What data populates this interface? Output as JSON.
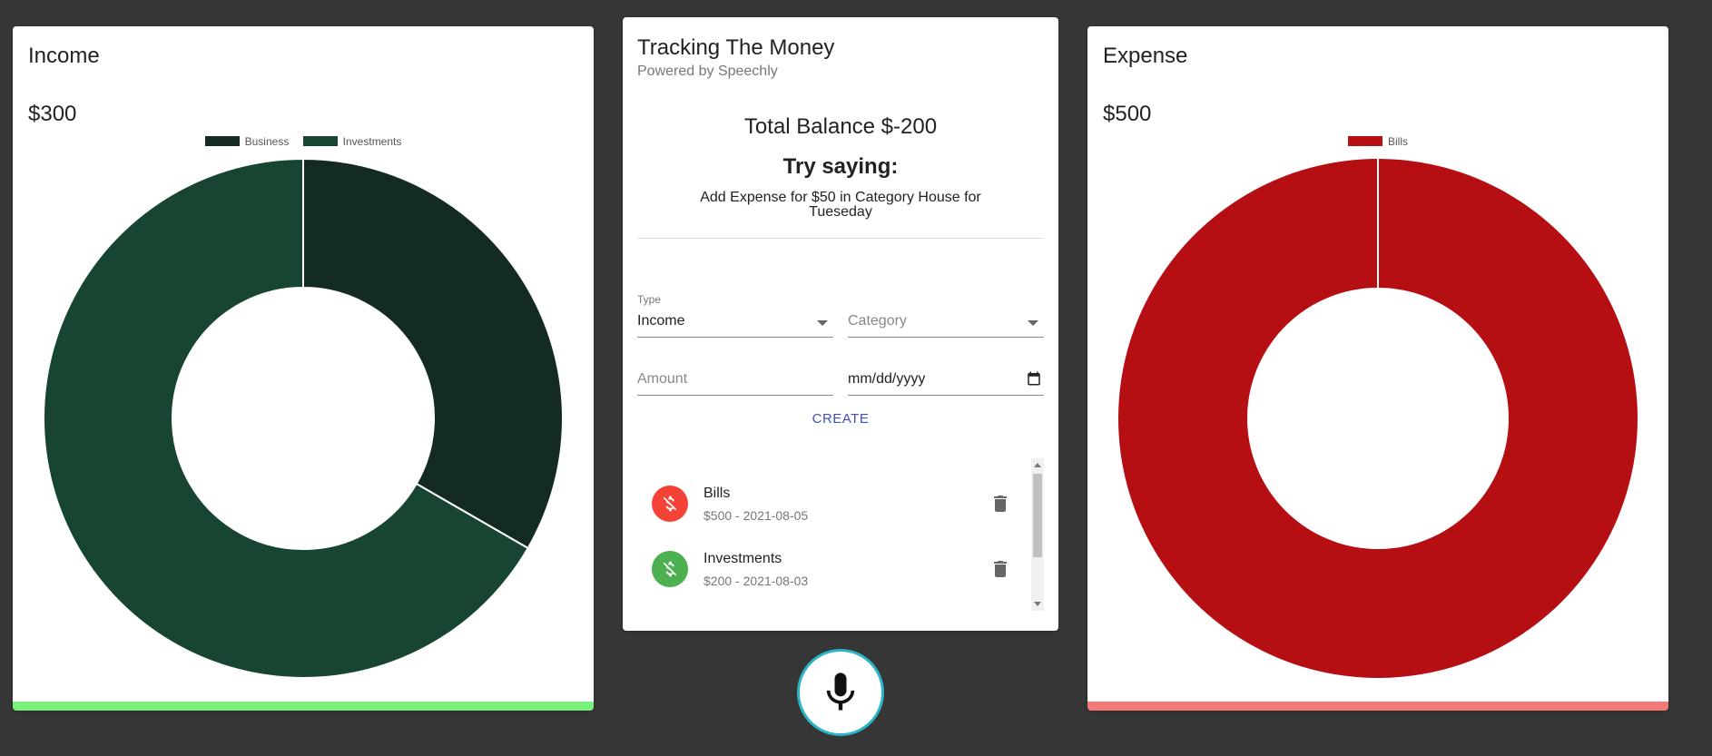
{
  "income": {
    "title": "Income",
    "amount": "$300",
    "legend": [
      {
        "label": "Business",
        "color": "#142b21"
      },
      {
        "label": "Investments",
        "color": "#174532"
      }
    ]
  },
  "expense": {
    "title": "Expense",
    "amount": "$500",
    "legend": [
      {
        "label": "Bills",
        "color": "#b50e13"
      }
    ]
  },
  "main": {
    "title": "Tracking The Money",
    "subtitle": "Powered by Speechly",
    "balance": "Total Balance $-200",
    "try_saying": "Try saying:",
    "hint": "Add Expense for $50 in Category House for Tueseday",
    "form": {
      "type_label": "Type",
      "type_value": "Income",
      "category_placeholder": "Category",
      "amount_placeholder": "Amount",
      "date_placeholder": "mm/dd/yyyy"
    },
    "create_label": "CREATE",
    "transactions": [
      {
        "name": "Bills",
        "detail": "$500 - 2021-08-05",
        "color": "#f44336",
        "icon": "money-off-icon"
      },
      {
        "name": "Investments",
        "detail": "$200 - 2021-08-03",
        "color": "#4caf50",
        "icon": "money-off-icon"
      }
    ]
  },
  "colors": {
    "background": "#363636",
    "income_bar": "#79f27c",
    "expense_bar": "#f47a78",
    "accent": "#3f51b5"
  },
  "chart_data": [
    {
      "type": "pie",
      "categories": [
        "Business",
        "Investments"
      ],
      "values": [
        100,
        200
      ],
      "colors": [
        "#142b21",
        "#174532"
      ],
      "title": "",
      "legend": "top"
    },
    {
      "type": "pie",
      "categories": [
        "Bills"
      ],
      "values": [
        500
      ],
      "colors": [
        "#b50e13"
      ],
      "title": "",
      "legend": "top"
    }
  ]
}
